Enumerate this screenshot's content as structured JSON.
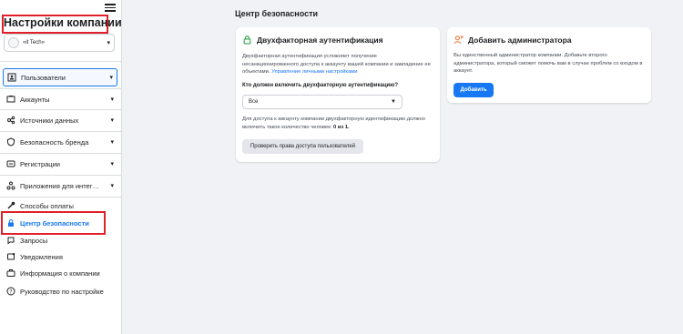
{
  "sidebar": {
    "title": "Настройки компании",
    "account": {
      "name": "«it Tech»"
    },
    "items": [
      {
        "label": "Пользователи",
        "icon": "users-icon",
        "has_chevron": true
      },
      {
        "label": "Аккаунты",
        "icon": "accounts-icon",
        "has_chevron": true
      },
      {
        "label": "Источники данных",
        "icon": "data-sources-icon",
        "has_chevron": true
      },
      {
        "label": "Безопасность бренда",
        "icon": "shield-icon",
        "has_chevron": true
      },
      {
        "label": "Регистрации",
        "icon": "registrations-icon",
        "has_chevron": true
      },
      {
        "label": "Приложения для интег…",
        "icon": "integrations-icon",
        "has_chevron": true
      },
      {
        "label": "Способы оплаты",
        "icon": "payment-icon",
        "has_chevron": false
      },
      {
        "label": "Центр безопасности",
        "icon": "lock-icon",
        "has_chevron": false
      },
      {
        "label": "Запросы",
        "icon": "requests-icon",
        "has_chevron": false
      },
      {
        "label": "Уведомления",
        "icon": "notifications-icon",
        "has_chevron": false
      },
      {
        "label": "Информация о компании",
        "icon": "briefcase-icon",
        "has_chevron": false
      },
      {
        "label": "Руководство по настройке",
        "icon": "help-icon",
        "has_chevron": false
      }
    ]
  },
  "main": {
    "title": "Центр безопасности",
    "two_factor": {
      "title": "Двухфакторная аутентификация",
      "description": "Двухфакторная аутентификация усложняет получение несанкционированного доступа к аккаунту вашей компании и завладение ее объектами.",
      "link": "Управление личными настройками",
      "question": "Кто должен включить двухфакторную аутентификацию?",
      "select_value": "Все",
      "requirement_text": "Для доступа к аккаунту компании двухфакторную идентификацию должно включить такое количество человек:",
      "requirement_count": "0 из 1",
      "check_button": "Проверить права доступа пользователей"
    },
    "add_admin": {
      "title": "Добавить администратора",
      "description": "Вы единственный администратор компании. Добавьте второго администратора, который сможет помочь вам в случае проблем со входом в аккаунт.",
      "button": "Добавить"
    }
  },
  "colors": {
    "accent": "#1877f2",
    "highlight": "#e0202a",
    "background": "#f0f2f5"
  }
}
